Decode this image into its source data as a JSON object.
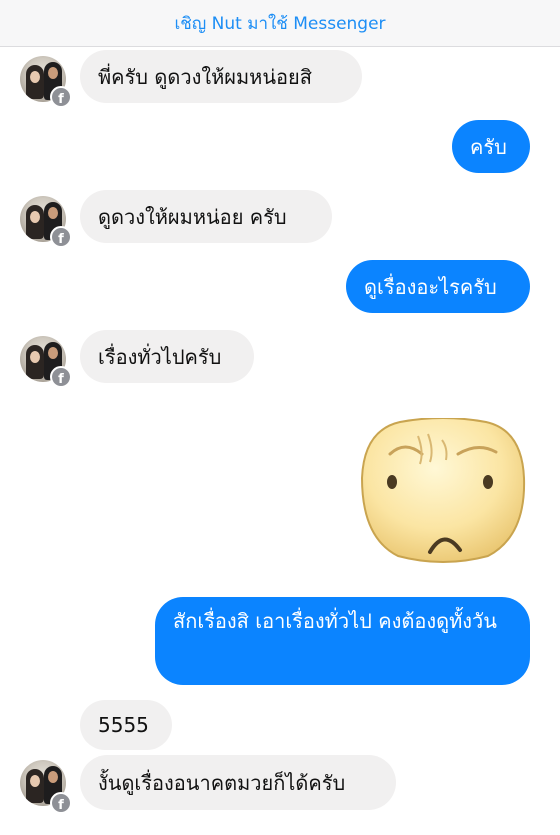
{
  "banner": {
    "text": "เชิญ Nut มาใช้ Messenger"
  },
  "messages": [
    {
      "sender": "them",
      "text": "พี่ครับ ดูดวงให้ผมหน่อยสิ"
    },
    {
      "sender": "me",
      "text": "ครับ"
    },
    {
      "sender": "them",
      "text": "ดูดวงให้ผมหน่อย ครับ"
    },
    {
      "sender": "me",
      "text": "ดูเรื่องอะไรครับ"
    },
    {
      "sender": "them",
      "text": "เรื่องทั่วไปครับ"
    },
    {
      "sender": "me",
      "type": "sticker",
      "sticker": "worried-face-sticker"
    },
    {
      "sender": "me",
      "text": "สักเรื่องสิ เอาเรื่องทั่วไป คงต้องดูทั้งวัน"
    },
    {
      "sender": "them",
      "text": "5555"
    },
    {
      "sender": "them",
      "text": "งั้นดูเรื่องอนาคตมวยก็ได้ครับ"
    }
  ],
  "avatar": {
    "badge_glyph": "f",
    "badge_icon": "facebook-icon"
  },
  "colors": {
    "outgoing_bubble": "#0b84ff",
    "incoming_bubble": "#f1f0f0",
    "banner_text": "#1d8ef5"
  }
}
